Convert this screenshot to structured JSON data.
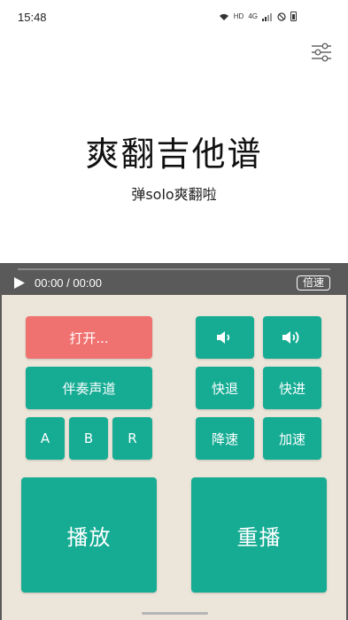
{
  "status": {
    "time": "15:48",
    "hd": "HD",
    "net": "4G"
  },
  "header": {
    "settings_icon": "sliders-icon"
  },
  "title": "爽翻吉他谱",
  "subtitle": "弹solo爽翻啦",
  "player": {
    "current": "00:00",
    "sep": "/",
    "total": "00:00",
    "speed": "倍速"
  },
  "controls": {
    "open": "打开...",
    "accompaniment": "伴奏声道",
    "a": "A",
    "b": "B",
    "r": "R",
    "vol_down_icon": "volume-down-icon",
    "vol_up_icon": "volume-up-icon",
    "rewind": "快退",
    "forward": "快进",
    "slow": "降速",
    "fast": "加速",
    "play": "播放",
    "replay": "重播"
  },
  "colors": {
    "teal": "#16ac94",
    "red": "#f07270",
    "panel": "#ece6da",
    "player_bar": "#5a5a5a"
  }
}
